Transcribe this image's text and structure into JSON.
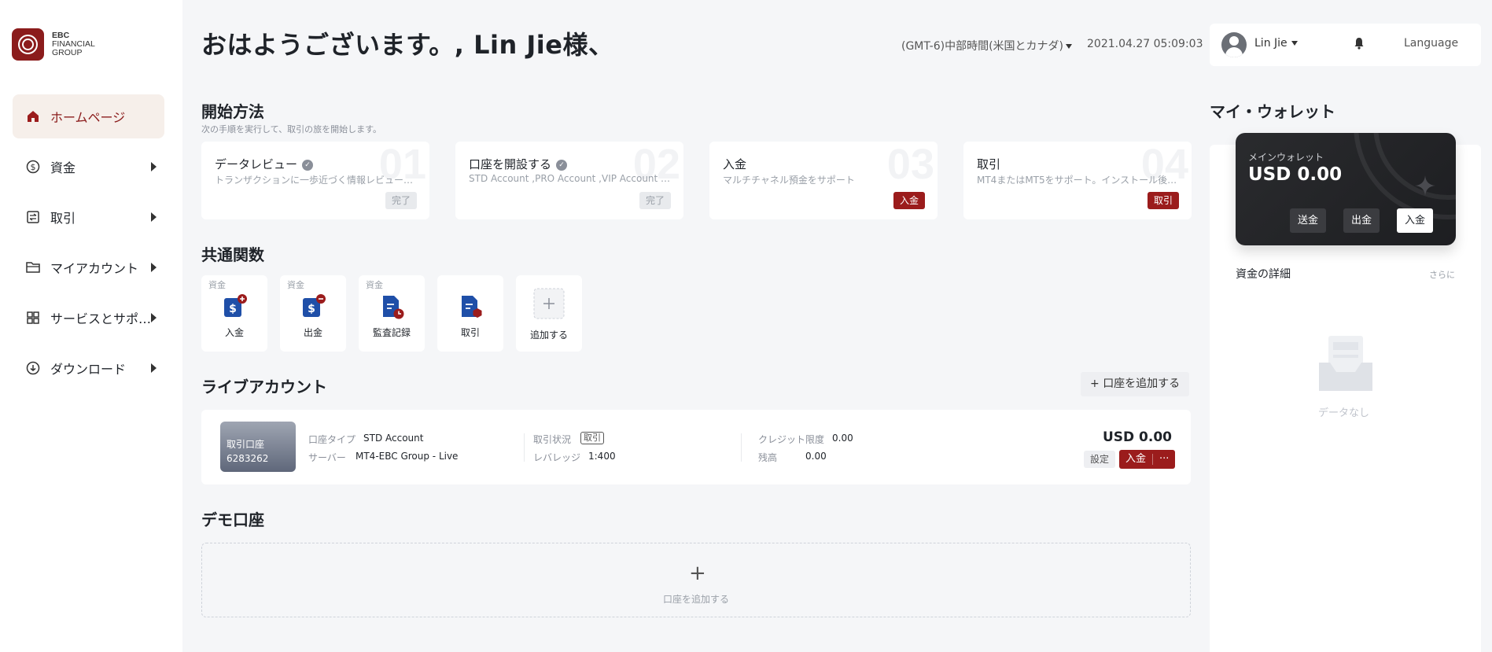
{
  "brand": {
    "line1": "EBC",
    "line2": "FINANCIAL",
    "line3": "GROUP"
  },
  "nav": [
    {
      "label": "ホームページ",
      "icon": "home-icon",
      "active": true
    },
    {
      "label": "資金",
      "icon": "dollar-icon"
    },
    {
      "label": "取引",
      "icon": "trade-icon"
    },
    {
      "label": "マイアカウント",
      "icon": "folder-icon"
    },
    {
      "label": "サービスとサポ…",
      "icon": "grid-icon"
    },
    {
      "label": "ダウンロード",
      "icon": "download-icon"
    }
  ],
  "header": {
    "greeting": "おはようございます。, Lin Jie様、",
    "timezone": "(GMT-6)中部時間(米国とカナダ)",
    "datetime": "2021.04.27 05:09:03",
    "username": "Lin Jie",
    "language": "Language"
  },
  "getting_started": {
    "title": "開始方法",
    "subtitle": "次の手順を実行して、取引の旅を開始します。",
    "steps": [
      {
        "num": "01",
        "title": "データレビュー",
        "desc": "トランザクションに一歩近づく情報レビュー…",
        "button": "完了",
        "done": true
      },
      {
        "num": "02",
        "title": "口座を開設する",
        "desc": "STD Account ,PRO Account ,VIP Account …",
        "button": "完了",
        "done": true
      },
      {
        "num": "03",
        "title": "入金",
        "desc": "マルチチャネル預金をサポート",
        "button": "入金",
        "done": false
      },
      {
        "num": "04",
        "title": "取引",
        "desc": "MT4またはMT5をサポート。インストール後…",
        "button": "取引",
        "done": false
      }
    ]
  },
  "functions": {
    "title": "共通関数",
    "items": [
      {
        "tag": "資金",
        "label": "入金",
        "icon": "deposit-icon"
      },
      {
        "tag": "資金",
        "label": "出金",
        "icon": "withdraw-icon"
      },
      {
        "tag": "資金",
        "label": "監査記録",
        "icon": "audit-record-icon"
      },
      {
        "tag": "",
        "label": "取引",
        "icon": "trade-doc-icon"
      },
      {
        "tag": "",
        "label": "追加する",
        "icon": "add-icon"
      }
    ]
  },
  "live": {
    "title": "ライブアカウント",
    "add_button": "口座を追加する",
    "account": {
      "thumb_title": "取引口座",
      "thumb_number": "6283262",
      "type_label": "口座タイプ",
      "type_value": "STD Account",
      "server_label": "サーバー",
      "server_value": "MT4-EBC Group - Live",
      "status_label": "取引状況",
      "status_value": "取引",
      "leverage_label": "レバレッジ",
      "leverage_value": "1:400",
      "credit_label": "クレジット限度",
      "credit_value": "0.00",
      "balance_label": "残高",
      "balance_value": "0.00",
      "total": "USD 0.00",
      "settings_button": "設定",
      "deposit_button": "入金",
      "more_button": "···"
    }
  },
  "demo": {
    "title": "デモ口座",
    "add_label": "口座を追加する"
  },
  "wallet": {
    "title": "マイ・ウォレット",
    "card_label": "メインウォレット",
    "card_value": "USD 0.00",
    "send": "送金",
    "withdraw": "出金",
    "deposit": "入金",
    "detail_title": "資金の詳細",
    "detail_more": "さらに",
    "empty": "データなし"
  },
  "colors": {
    "accent": "#9b1c1c",
    "active_bg": "#f6efea",
    "page_bg": "#f5f6f8"
  }
}
